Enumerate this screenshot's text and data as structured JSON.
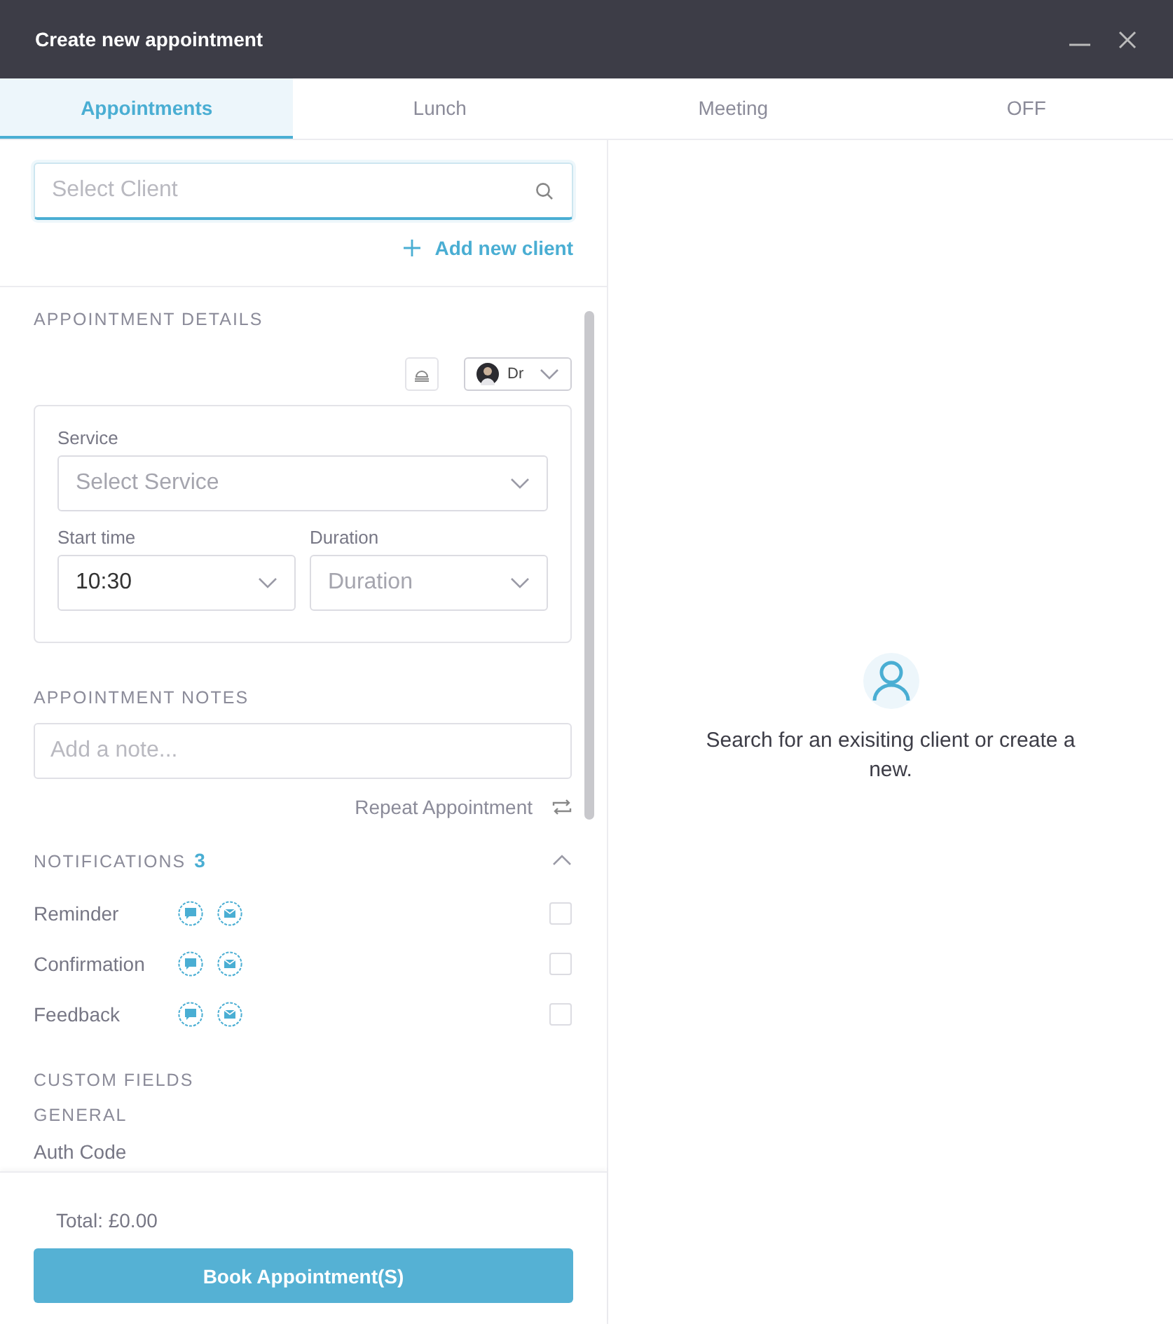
{
  "window": {
    "title": "Create new appointment"
  },
  "tabs": [
    {
      "label": "Appointments",
      "selected": true
    },
    {
      "label": "Lunch",
      "selected": false
    },
    {
      "label": "Meeting",
      "selected": false
    },
    {
      "label": "OFF",
      "selected": false
    }
  ],
  "client_search": {
    "placeholder": "Select Client"
  },
  "add_client": "Add new client",
  "details": {
    "heading": "APPOINTMENT DETAILS",
    "staff": "Dr",
    "service": {
      "label": "Service",
      "placeholder": "Select Service"
    },
    "start_time": {
      "label": "Start time",
      "value": "10:30"
    },
    "duration": {
      "label": "Duration",
      "placeholder": "Duration"
    }
  },
  "notes": {
    "heading": "APPOINTMENT NOTES",
    "placeholder": "Add a note...",
    "repeat": "Repeat Appointment"
  },
  "notifications": {
    "heading": "NOTIFICATIONS",
    "count": "3",
    "expanded": true,
    "items": [
      {
        "label": "Reminder",
        "checked": false
      },
      {
        "label": "Confirmation",
        "checked": false
      },
      {
        "label": "Feedback",
        "checked": false
      }
    ]
  },
  "custom_fields": {
    "heading": "CUSTOM FIELDS",
    "group": "GENERAL",
    "fields": [
      "Auth Code"
    ]
  },
  "footer": {
    "total": "Total: £0.00",
    "button": "Book Appointment(S)"
  },
  "empty_state": {
    "message": "Search for an exisiting client or create a new."
  }
}
